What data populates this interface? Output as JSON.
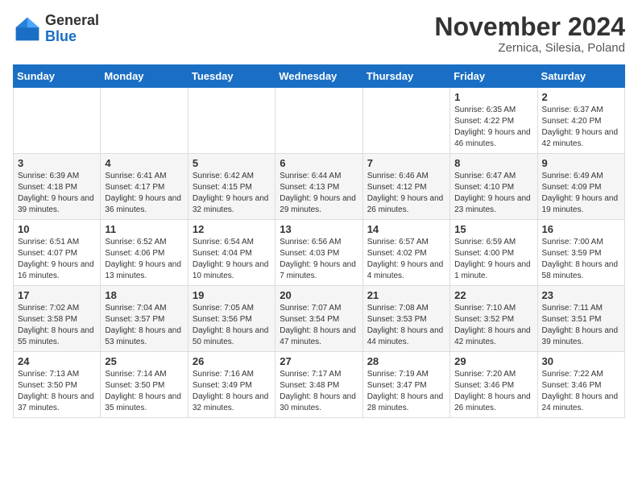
{
  "header": {
    "logo_line1": "General",
    "logo_line2": "Blue",
    "month": "November 2024",
    "location": "Zernica, Silesia, Poland"
  },
  "weekdays": [
    "Sunday",
    "Monday",
    "Tuesday",
    "Wednesday",
    "Thursday",
    "Friday",
    "Saturday"
  ],
  "weeks": [
    [
      {
        "day": "",
        "info": ""
      },
      {
        "day": "",
        "info": ""
      },
      {
        "day": "",
        "info": ""
      },
      {
        "day": "",
        "info": ""
      },
      {
        "day": "",
        "info": ""
      },
      {
        "day": "1",
        "info": "Sunrise: 6:35 AM\nSunset: 4:22 PM\nDaylight: 9 hours and 46 minutes."
      },
      {
        "day": "2",
        "info": "Sunrise: 6:37 AM\nSunset: 4:20 PM\nDaylight: 9 hours and 42 minutes."
      }
    ],
    [
      {
        "day": "3",
        "info": "Sunrise: 6:39 AM\nSunset: 4:18 PM\nDaylight: 9 hours and 39 minutes."
      },
      {
        "day": "4",
        "info": "Sunrise: 6:41 AM\nSunset: 4:17 PM\nDaylight: 9 hours and 36 minutes."
      },
      {
        "day": "5",
        "info": "Sunrise: 6:42 AM\nSunset: 4:15 PM\nDaylight: 9 hours and 32 minutes."
      },
      {
        "day": "6",
        "info": "Sunrise: 6:44 AM\nSunset: 4:13 PM\nDaylight: 9 hours and 29 minutes."
      },
      {
        "day": "7",
        "info": "Sunrise: 6:46 AM\nSunset: 4:12 PM\nDaylight: 9 hours and 26 minutes."
      },
      {
        "day": "8",
        "info": "Sunrise: 6:47 AM\nSunset: 4:10 PM\nDaylight: 9 hours and 23 minutes."
      },
      {
        "day": "9",
        "info": "Sunrise: 6:49 AM\nSunset: 4:09 PM\nDaylight: 9 hours and 19 minutes."
      }
    ],
    [
      {
        "day": "10",
        "info": "Sunrise: 6:51 AM\nSunset: 4:07 PM\nDaylight: 9 hours and 16 minutes."
      },
      {
        "day": "11",
        "info": "Sunrise: 6:52 AM\nSunset: 4:06 PM\nDaylight: 9 hours and 13 minutes."
      },
      {
        "day": "12",
        "info": "Sunrise: 6:54 AM\nSunset: 4:04 PM\nDaylight: 9 hours and 10 minutes."
      },
      {
        "day": "13",
        "info": "Sunrise: 6:56 AM\nSunset: 4:03 PM\nDaylight: 9 hours and 7 minutes."
      },
      {
        "day": "14",
        "info": "Sunrise: 6:57 AM\nSunset: 4:02 PM\nDaylight: 9 hours and 4 minutes."
      },
      {
        "day": "15",
        "info": "Sunrise: 6:59 AM\nSunset: 4:00 PM\nDaylight: 9 hours and 1 minute."
      },
      {
        "day": "16",
        "info": "Sunrise: 7:00 AM\nSunset: 3:59 PM\nDaylight: 8 hours and 58 minutes."
      }
    ],
    [
      {
        "day": "17",
        "info": "Sunrise: 7:02 AM\nSunset: 3:58 PM\nDaylight: 8 hours and 55 minutes."
      },
      {
        "day": "18",
        "info": "Sunrise: 7:04 AM\nSunset: 3:57 PM\nDaylight: 8 hours and 53 minutes."
      },
      {
        "day": "19",
        "info": "Sunrise: 7:05 AM\nSunset: 3:56 PM\nDaylight: 8 hours and 50 minutes."
      },
      {
        "day": "20",
        "info": "Sunrise: 7:07 AM\nSunset: 3:54 PM\nDaylight: 8 hours and 47 minutes."
      },
      {
        "day": "21",
        "info": "Sunrise: 7:08 AM\nSunset: 3:53 PM\nDaylight: 8 hours and 44 minutes."
      },
      {
        "day": "22",
        "info": "Sunrise: 7:10 AM\nSunset: 3:52 PM\nDaylight: 8 hours and 42 minutes."
      },
      {
        "day": "23",
        "info": "Sunrise: 7:11 AM\nSunset: 3:51 PM\nDaylight: 8 hours and 39 minutes."
      }
    ],
    [
      {
        "day": "24",
        "info": "Sunrise: 7:13 AM\nSunset: 3:50 PM\nDaylight: 8 hours and 37 minutes."
      },
      {
        "day": "25",
        "info": "Sunrise: 7:14 AM\nSunset: 3:50 PM\nDaylight: 8 hours and 35 minutes."
      },
      {
        "day": "26",
        "info": "Sunrise: 7:16 AM\nSunset: 3:49 PM\nDaylight: 8 hours and 32 minutes."
      },
      {
        "day": "27",
        "info": "Sunrise: 7:17 AM\nSunset: 3:48 PM\nDaylight: 8 hours and 30 minutes."
      },
      {
        "day": "28",
        "info": "Sunrise: 7:19 AM\nSunset: 3:47 PM\nDaylight: 8 hours and 28 minutes."
      },
      {
        "day": "29",
        "info": "Sunrise: 7:20 AM\nSunset: 3:46 PM\nDaylight: 8 hours and 26 minutes."
      },
      {
        "day": "30",
        "info": "Sunrise: 7:22 AM\nSunset: 3:46 PM\nDaylight: 8 hours and 24 minutes."
      }
    ]
  ]
}
